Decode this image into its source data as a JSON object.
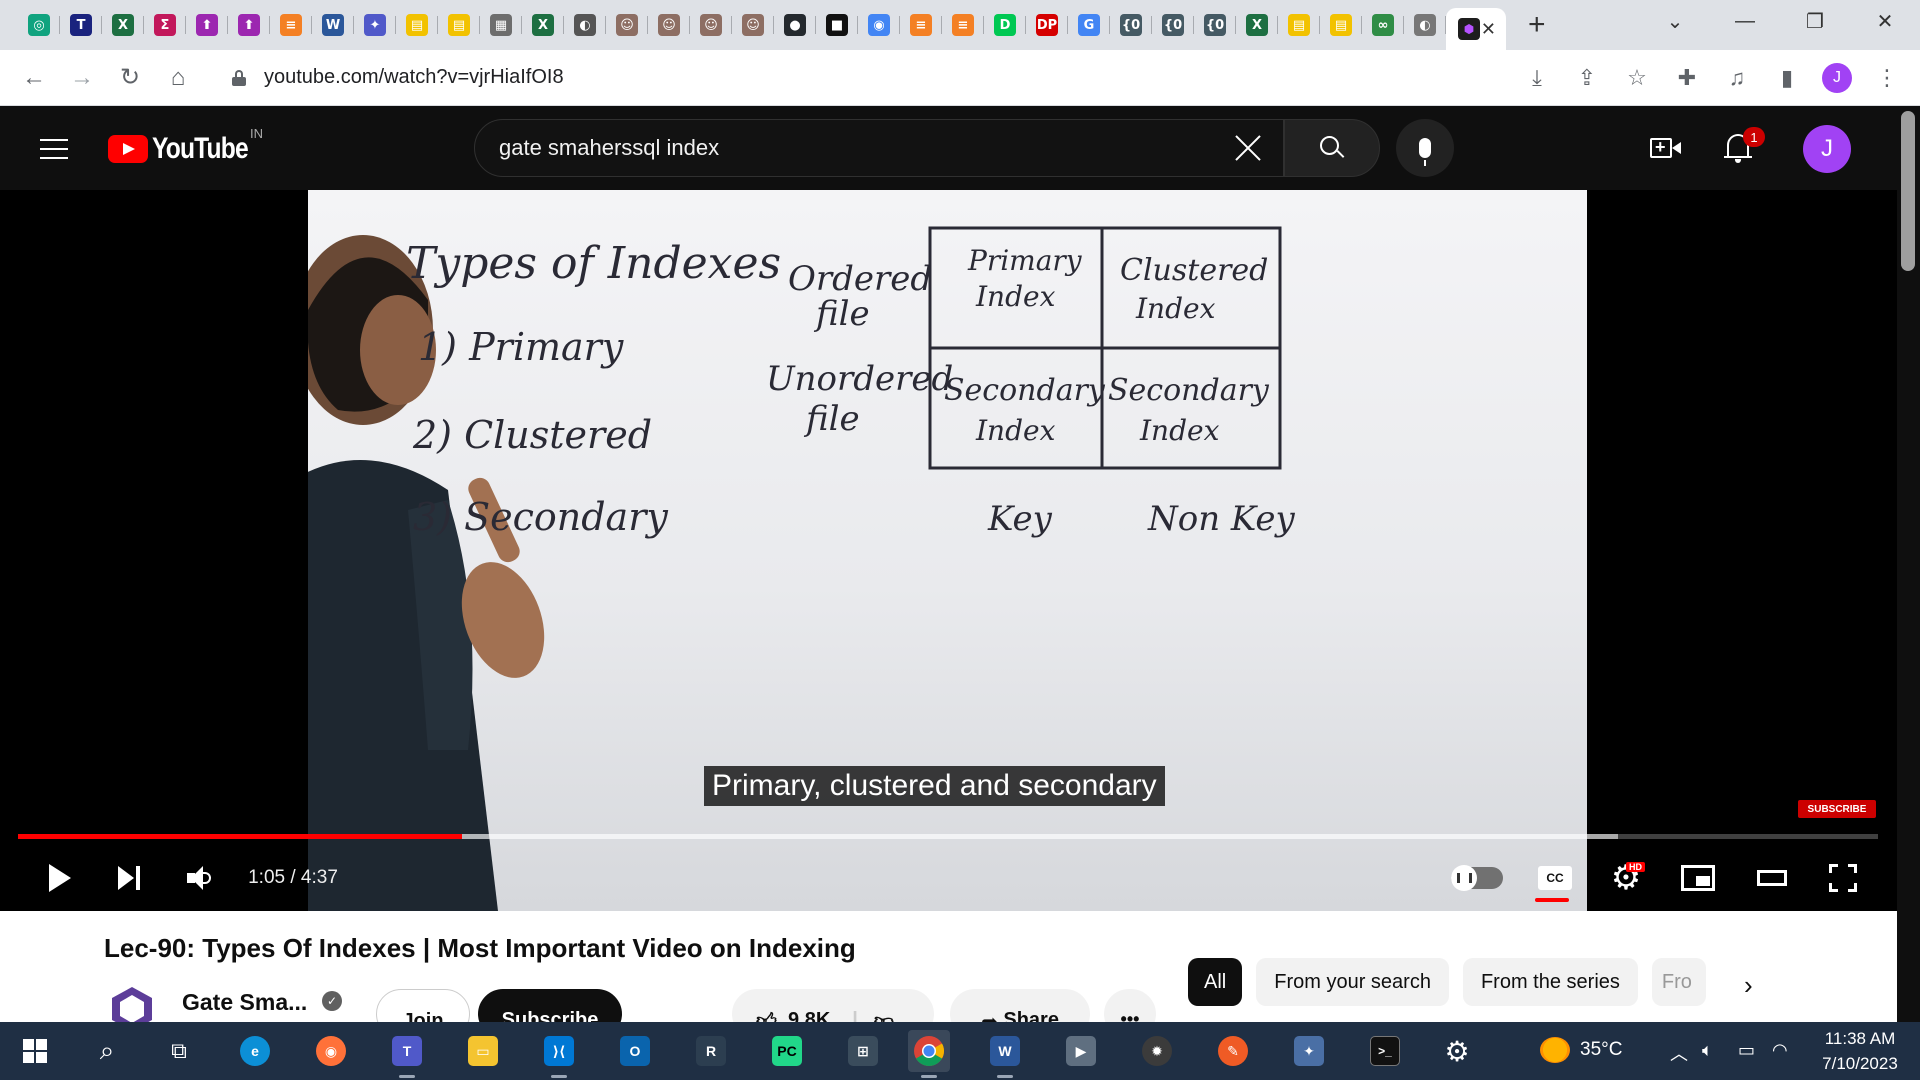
{
  "browser": {
    "tabs": [
      {
        "icon": "chatgpt-icon",
        "glyph": "◎",
        "color": "#10a37f"
      },
      {
        "icon": "typora-icon",
        "glyph": "T",
        "color": "#1a237e"
      },
      {
        "icon": "excel-icon",
        "glyph": "X",
        "color": "#1d6f42"
      },
      {
        "icon": "sigma-icon",
        "glyph": "Σ",
        "color": "#c2185b"
      },
      {
        "icon": "pin-icon",
        "glyph": "⬆",
        "color": "#9c27b0"
      },
      {
        "icon": "pin-icon",
        "glyph": "⬆",
        "color": "#9c27b0"
      },
      {
        "icon": "stackoverflow-icon",
        "glyph": "≡",
        "color": "#f48024"
      },
      {
        "icon": "word-icon",
        "glyph": "W",
        "color": "#2b579a"
      },
      {
        "icon": "teams-icon",
        "glyph": "✦",
        "color": "#5059c9"
      },
      {
        "icon": "notes-icon",
        "glyph": "▤",
        "color": "#f2c200"
      },
      {
        "icon": "notes-icon",
        "glyph": "▤",
        "color": "#f2c200"
      },
      {
        "icon": "image-icon",
        "glyph": "▦",
        "color": "#6d6d6d"
      },
      {
        "icon": "excel-icon",
        "glyph": "X",
        "color": "#1d6f42"
      },
      {
        "icon": "globe-icon",
        "glyph": "◐",
        "color": "#555555"
      },
      {
        "icon": "portrait-icon",
        "glyph": "☺",
        "color": "#8d6e63"
      },
      {
        "icon": "portrait-icon",
        "glyph": "☺",
        "color": "#8d6e63"
      },
      {
        "icon": "portrait-icon",
        "glyph": "☺",
        "color": "#8d6e63"
      },
      {
        "icon": "portrait-icon",
        "glyph": "☺",
        "color": "#8d6e63"
      },
      {
        "icon": "github-icon",
        "glyph": "●",
        "color": "#24292e"
      },
      {
        "icon": "square-icon",
        "glyph": "■",
        "color": "#111111"
      },
      {
        "icon": "lens-icon",
        "glyph": "◉",
        "color": "#4285f4"
      },
      {
        "icon": "stackoverflow-icon",
        "glyph": "≡",
        "color": "#f48024"
      },
      {
        "icon": "stackoverflow-icon",
        "glyph": "≡",
        "color": "#f48024"
      },
      {
        "icon": "discord-icon",
        "glyph": "D",
        "color": "#00c853"
      },
      {
        "icon": "dp-icon",
        "glyph": "DP",
        "color": "#d50000"
      },
      {
        "icon": "google-icon",
        "glyph": "G",
        "color": "#4285f4"
      },
      {
        "icon": "json-icon",
        "glyph": "{0",
        "color": "#455a64"
      },
      {
        "icon": "json-icon",
        "glyph": "{0",
        "color": "#455a64"
      },
      {
        "icon": "json-icon",
        "glyph": "{0",
        "color": "#455a64"
      },
      {
        "icon": "excel-icon",
        "glyph": "X",
        "color": "#1d6f42"
      },
      {
        "icon": "notes-icon",
        "glyph": "▤",
        "color": "#f2c200"
      },
      {
        "icon": "notes-icon",
        "glyph": "▤",
        "color": "#f2c200"
      },
      {
        "icon": "gfg-icon",
        "glyph": "∞",
        "color": "#2f8d46"
      },
      {
        "icon": "globe-icon",
        "glyph": "◐",
        "color": "#777777"
      }
    ],
    "active_tab_icon": "youtube-icon",
    "new_tab": "+",
    "url": "youtube.com/watch?v=vjrHiaIfOI8"
  },
  "youtube": {
    "logo_text": "YouTube",
    "region": "IN",
    "search_query": "gate smaherssql index",
    "notification_count": "1",
    "avatar_letter": "J"
  },
  "video": {
    "board": {
      "title": "Types of Indexes",
      "list": [
        "1)  Primary",
        "2)  Clustered",
        "3)  Secondary"
      ],
      "row_labels": [
        "Ordered",
        "file",
        "Unordered",
        "file"
      ],
      "cells": [
        "Primary",
        "Index",
        "Clustered",
        "Index",
        "Secondary",
        "Index",
        "Secondary",
        "Index"
      ],
      "col_labels": [
        "Key",
        "Non Key"
      ]
    },
    "caption": "Primary, clustered and secondary",
    "watermark": "SUBSCRIBE",
    "time": "1:05 / 4:37",
    "progress_played": 0.2387,
    "progress_buffered": 0.8602,
    "hd_badge": "HD",
    "cc_label": "CC"
  },
  "below": {
    "title": "Lec-90: Types Of Indexes | Most Important Video on Indexing",
    "channel": "Gate Sma...",
    "join": "Join",
    "subscribe": "Subscribe",
    "likes": "9.8K",
    "share": "Share",
    "more": "•••",
    "chips": [
      "All",
      "From your search",
      "From the series",
      "Fro"
    ]
  },
  "taskbar": {
    "temperature": "35°C",
    "time": "11:38 AM",
    "date": "7/10/2023"
  }
}
